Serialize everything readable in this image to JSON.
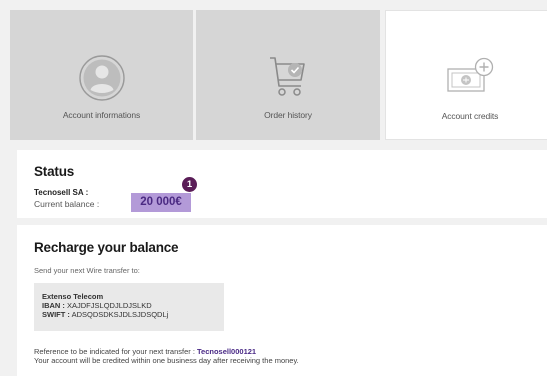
{
  "tabs": [
    {
      "label": "Account informations",
      "icon": "user-icon"
    },
    {
      "label": "Order history",
      "icon": "cart-check-icon"
    },
    {
      "label": "Account credits",
      "icon": "add-credit-icon"
    }
  ],
  "status": {
    "title": "Status",
    "company": "Tecnosell SA :",
    "balance_label": "Current balance :",
    "balance_value": "20 000€",
    "callout_number": "1"
  },
  "recharge": {
    "title": "Recharge your balance",
    "send_to": "Send your next Wire transfer to:",
    "bank_name": "Extenso Telecom",
    "iban_label": "IBAN :",
    "iban_value": "XAJDFJSLQDJLDJSLKD",
    "swift_label": "SWIFT :",
    "swift_value": "ADSQDSDKSJDLSJDSQDLj",
    "reference_text": "Reference to be indicated for your next transfer :",
    "reference_code": "Tecnosell000121",
    "credit_note": "Your account will be credited within one business day after receiving the money."
  },
  "colors": {
    "tab_inactive": "#d6d6d6",
    "tab_active": "#ffffff",
    "balance_highlight": "#b39ad8",
    "callout": "#5a1d57",
    "reference_code": "#4a2a86"
  }
}
